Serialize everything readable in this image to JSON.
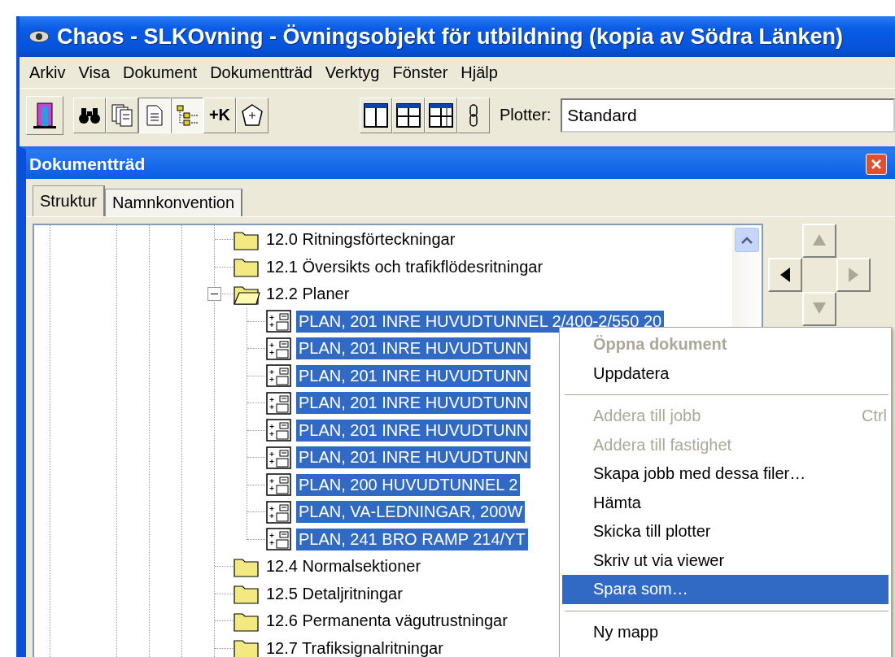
{
  "window": {
    "title": "Chaos - SLKOvning - Övningsobjekt för utbildning (kopia av Södra Länken)"
  },
  "menu_bar": [
    "Arkiv",
    "Visa",
    "Dokument",
    "Dokumentträd",
    "Verktyg",
    "Fönster",
    "Hjälp"
  ],
  "toolbar": {
    "groups": [
      {
        "buttons": [
          {
            "pressed": false
          }
        ]
      },
      {
        "buttons": [
          {
            "pressed": false
          },
          {
            "pressed": false
          },
          {
            "pressed": true
          },
          {
            "pressed": true
          },
          {
            "pressed": false,
            "label": "+K"
          },
          {
            "pressed": false
          }
        ]
      },
      {
        "buttons": [
          {
            "pressed": false
          },
          {
            "pressed": false
          },
          {
            "pressed": false
          },
          {
            "pressed": false
          }
        ]
      }
    ],
    "plotter_label": "Plotter:",
    "plotter_value": "Standard"
  },
  "panel": {
    "title": "Dokumentträd",
    "tabs": [
      {
        "label": "Struktur",
        "selected": true
      },
      {
        "label": "Namnkonvention",
        "selected": false
      }
    ],
    "tree": [
      {
        "label": "12.0 Ritningsförteckningar",
        "expanded": false
      },
      {
        "label": "12.1 Översikts och trafikflödesritningar",
        "expanded": false
      },
      {
        "label": "12.2 Planer",
        "expanded": true,
        "children": [
          {
            "label": "PLAN, 201 INRE HUVUDTUNNEL 2/400-2/550 20",
            "selected": true
          },
          {
            "label": "PLAN, 201 INRE HUVUDTUNN",
            "selected": true
          },
          {
            "label": "PLAN, 201 INRE HUVUDTUNN",
            "selected": true
          },
          {
            "label": "PLAN, 201 INRE HUVUDTUNN",
            "selected": true
          },
          {
            "label": "PLAN, 201 INRE HUVUDTUNN",
            "selected": true
          },
          {
            "label": "PLAN, 201 INRE HUVUDTUNN",
            "selected": true
          },
          {
            "label": "PLAN, 200 HUVUDTUNNEL 2",
            "selected": true
          },
          {
            "label": "PLAN, VA-LEDNINGAR, 200W",
            "selected": true
          },
          {
            "label": "PLAN, 241 BRO RAMP 214/YT",
            "selected": true
          }
        ]
      },
      {
        "label": "12.4 Normalsektioner",
        "expanded": false
      },
      {
        "label": "12.5 Detaljritningar",
        "expanded": false
      },
      {
        "label": "12.6 Permanenta vägutrustningar",
        "expanded": false
      },
      {
        "label": "12.7 Trafiksignalritningar",
        "expanded": false
      }
    ],
    "nav": [
      {
        "disabled": true
      },
      {
        "disabled": false
      },
      {
        "disabled": true
      },
      {
        "disabled": true
      }
    ]
  },
  "context_menu": [
    {
      "kind": "default",
      "label": "Öppna dokument",
      "disabled": true,
      "selected": false
    },
    {
      "kind": "item",
      "label": "Uppdatera",
      "disabled": false,
      "selected": false
    },
    {
      "kind": "separator"
    },
    {
      "kind": "item",
      "label": "Addera till jobb",
      "shortcut": "Ctrl",
      "disabled": true,
      "selected": false
    },
    {
      "kind": "item",
      "label": "Addera till fastighet",
      "disabled": true,
      "selected": false
    },
    {
      "kind": "item",
      "label": "Skapa jobb med dessa filer…",
      "disabled": false,
      "selected": false
    },
    {
      "kind": "item",
      "label": "Hämta",
      "disabled": false,
      "selected": false
    },
    {
      "kind": "item",
      "label": "Skicka till plotter",
      "disabled": false,
      "selected": false
    },
    {
      "kind": "item",
      "label": "Skriv ut via viewer",
      "disabled": false,
      "selected": false
    },
    {
      "kind": "item",
      "label": "Spara som…",
      "disabled": false,
      "selected": true
    },
    {
      "kind": "separator"
    },
    {
      "kind": "item",
      "label": "Ny mapp",
      "disabled": false,
      "selected": false
    }
  ]
}
